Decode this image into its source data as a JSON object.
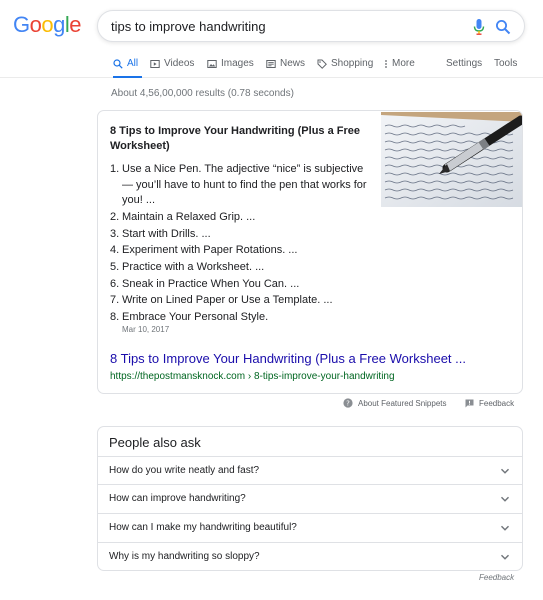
{
  "logo": {
    "letters": [
      "G",
      "o",
      "o",
      "g",
      "l",
      "e"
    ],
    "colors": [
      "#4285F4",
      "#EA4335",
      "#FBBC05",
      "#4285F4",
      "#34A853",
      "#EA4335"
    ]
  },
  "search": {
    "query": "tips to improve handwriting",
    "mic_icon": "mic-icon",
    "search_icon": "search-icon"
  },
  "tabs": [
    {
      "label": "All",
      "icon": "search-icon",
      "active": true
    },
    {
      "label": "Videos",
      "icon": "video-icon"
    },
    {
      "label": "Images",
      "icon": "image-icon"
    },
    {
      "label": "News",
      "icon": "news-icon"
    },
    {
      "label": "Shopping",
      "icon": "tag-icon"
    },
    {
      "label": "More",
      "icon": "more-icon"
    }
  ],
  "tools": {
    "settings": "Settings",
    "tools": "Tools"
  },
  "results_count": "About 4,56,00,000 results (0.78 seconds)",
  "featured_snippet": {
    "title": "8 Tips to Improve Your Handwriting (Plus a Free Worksheet)",
    "items": [
      {
        "num": "1.",
        "text": "Use a Nice Pen. The adjective “nice” is subjective — you’ll have to hunt to find the pen that works for you! ..."
      },
      {
        "num": "2.",
        "text": "Maintain a Relaxed Grip. ..."
      },
      {
        "num": "3.",
        "text": "Start with Drills. ..."
      },
      {
        "num": "4.",
        "text": "Experiment with Paper Rotations. ..."
      },
      {
        "num": "5.",
        "text": "Practice with a Worksheet. ..."
      },
      {
        "num": "6.",
        "text": "Sneak in Practice When You Can. ..."
      },
      {
        "num": "7.",
        "text": "Write on Lined Paper or Use a Template. ..."
      },
      {
        "num": "8.",
        "text": "Embrace Your Personal Style."
      }
    ],
    "date": "Mar 10, 2017",
    "link_text": "8 Tips to Improve Your Handwriting (Plus a Free Worksheet ...",
    "url": "https://thepostmansknock.com › 8-tips-improve-your-handwriting",
    "about_label": "About Featured Snippets",
    "feedback_label": "Feedback"
  },
  "people_also_ask": {
    "title": "People also ask",
    "questions": [
      "How do you write neatly and fast?",
      "How can improve handwriting?",
      "How can I make my handwriting beautiful?",
      "Why is my handwriting so sloppy?"
    ],
    "feedback_label": "Feedback"
  },
  "colors": {
    "accent": "#1a73e8",
    "link": "#1a0dab",
    "url": "#006621"
  }
}
